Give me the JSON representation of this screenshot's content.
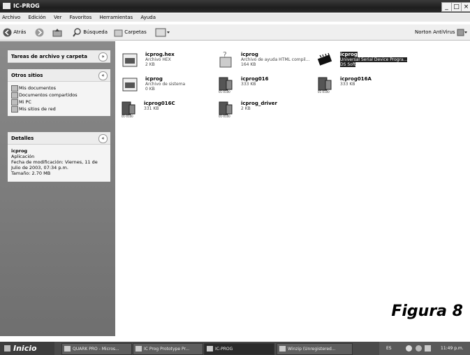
{
  "window": {
    "title": "IC-PROG",
    "minimize": "_",
    "maximize": "□",
    "close": "×"
  },
  "menu": [
    "Archivo",
    "Edición",
    "Ver",
    "Favoritos",
    "Herramientas",
    "Ayuda"
  ],
  "toolbar": {
    "back": "Atrás",
    "search": "Búsqueda",
    "folders": "Carpetas",
    "norton": "Norton AntiVirus"
  },
  "left": {
    "tasks_title": "Tareas de archivo y carpeta",
    "other_title": "Otros sitios",
    "other_links": [
      "Mis documentos",
      "Documentos compartidos",
      "Mi PC",
      "Mis sitios de red"
    ],
    "details_title": "Detalles",
    "details": {
      "name": "icprog",
      "type": "Aplicación",
      "modified": "Fecha de modificación: Viernes, 11 de Julio de 2003, 07:34 p.m.",
      "size": "Tamaño: 2.70 MB"
    }
  },
  "files": [
    {
      "name": "icprog.hex",
      "l2": "Archivo HEX",
      "l3": "2 KB"
    },
    {
      "name": "icprog",
      "l2": "Archivo de ayuda HTML compil...",
      "l3": "164 KB"
    },
    {
      "name": "icprog",
      "l2": "Universal Serial Device Progra...",
      "l3": "DS Soft"
    },
    {
      "name": "icprog",
      "l2": "Archivo de sistema",
      "l3": "0 KB"
    },
    {
      "name": "icprog016",
      "l2": "333 KB",
      "l3": ""
    },
    {
      "name": "icprog016A",
      "l2": "333 KB",
      "l3": ""
    },
    {
      "name": "icprog016C",
      "l2": "331 KB",
      "l3": ""
    },
    {
      "name": "icprog_driver",
      "l2": "2 KB",
      "l3": ""
    }
  ],
  "caption": "Figura 8",
  "taskbar": {
    "start": "Inicio",
    "items": [
      "QUARK PRO - Micros...",
      "IC Prog Prototype Pr...",
      "IC-PROG",
      "Winzip (Unregistered..."
    ],
    "lang": "ES",
    "clock": "11:49 p.m."
  }
}
